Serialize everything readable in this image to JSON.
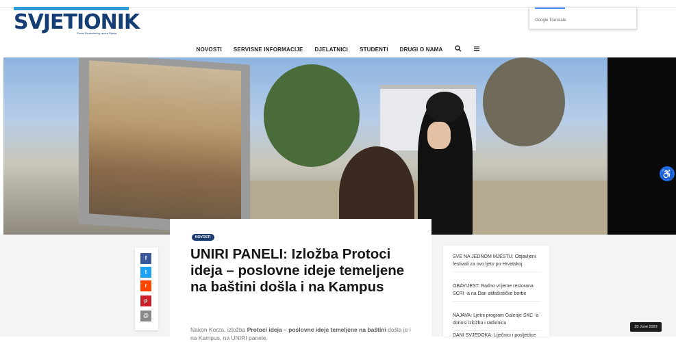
{
  "header": {
    "logo_text": "SVJETIONIK",
    "logo_tagline": "Portal Studentskog centra Rijeka",
    "translate_label": "Google Translate"
  },
  "nav": {
    "items": [
      "NOVOSTI",
      "SERVISNE INFORMACIJE",
      "DJELATNICI",
      "STUDENTI",
      "DRUGI O NAMA"
    ],
    "search_icon": "search-icon",
    "menu_icon": "menu-icon"
  },
  "article": {
    "category": "NOVOSTI",
    "title": "UNIRI PANELI: Izložba Protoci ideja – poslovne ideje temeljene na baštini došla i na Kampus",
    "excerpt_prefix": "Nakon Korza, izložba ",
    "excerpt_bold": "Protoci ideja – poslovne ideje temeljene na baštini",
    "excerpt_suffix": " došla je i na Kampus, na UNIRI panele."
  },
  "share": [
    {
      "name": "facebook",
      "glyph": "f",
      "color": "#3b5998"
    },
    {
      "name": "twitter",
      "glyph": "t",
      "color": "#1da1f2"
    },
    {
      "name": "reddit",
      "glyph": "r",
      "color": "#ff4500"
    },
    {
      "name": "pinterest",
      "glyph": "p",
      "color": "#cb2027"
    },
    {
      "name": "email",
      "glyph": "@",
      "color": "#888888"
    }
  ],
  "sidebar": {
    "items": [
      "SVE NA JEDNOM MJESTU: Objavljeni festivali za ovo ljeto po Hrvatskoj",
      "OBAVIJEST: Radno vrijeme restorana SCRI -a na Dan atifašističke borbe",
      "NAJAVA: Ljetni program Galerije SKC -a donosi izložbu i radionicu",
      "DANI SVJEDOKA: Liječnici i posljedice"
    ]
  },
  "date_badge": "20 June 2023",
  "accessibility_icon": "accessibility-icon",
  "colors": {
    "brand": "#153e75",
    "accent": "#2a9ad8",
    "badge": "#1a3b6e"
  }
}
